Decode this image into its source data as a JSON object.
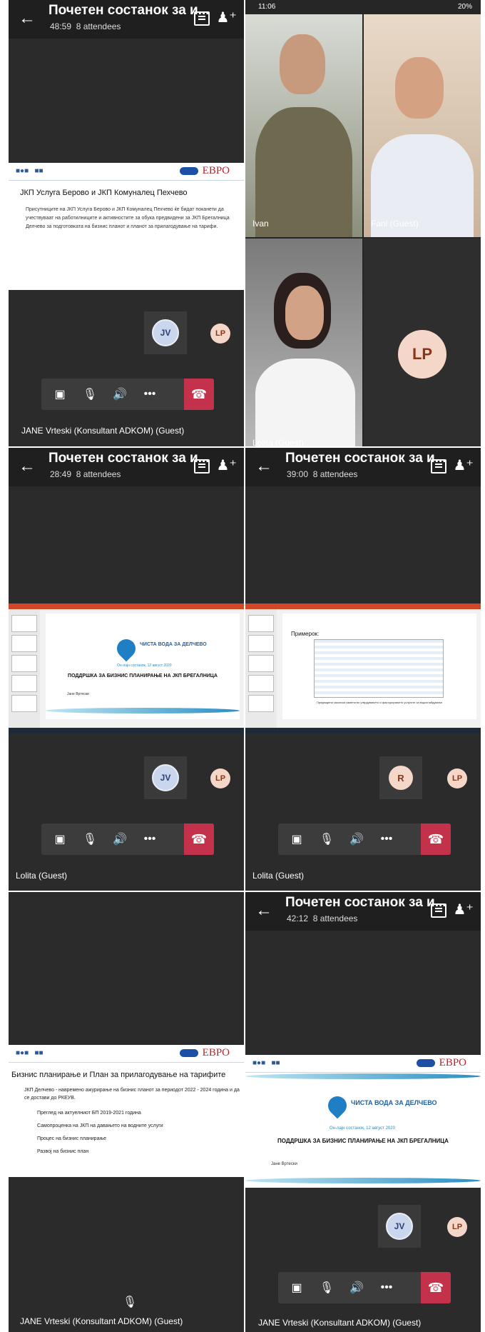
{
  "panels": {
    "p1": {
      "meeting_title": "Почетен состанок за и...",
      "timer": "48:59",
      "attendees": "8 attendees",
      "slide": {
        "title": "ЈКП Услуга Берово и ЈКП Комуналец Пехчево",
        "body": "Присутниците на ЈКП Услуга Берово и ЈКП Комуналец Пехчево ќе бидат поканети да учествуваат на работилниците и активностите за обука предвидени за ЈКП Брегалница Делчево за подготовката на бизнис планот и планот за прилагодување на тарифи.",
        "evro": "EBPO"
      },
      "avatar_tile": "JV",
      "avatar_small": "LP",
      "participant_name": "JANE  Vrteski (Konsultant ADKOM) (Guest)"
    },
    "p2": {
      "status_time": "11:06",
      "status_right": "20%",
      "tiles": [
        {
          "name": "Ivan"
        },
        {
          "name": "Fani (Guest)"
        },
        {
          "name": "Lolita (Guest)"
        }
      ],
      "avatar_big": "LP"
    },
    "p3": {
      "meeting_title": "Почетен состанок за и...",
      "timer": "28:49",
      "attendees": "8 attendees",
      "slide": {
        "brand": "ЧИСТА ВОДА ЗА ДЕЛЧЕВО",
        "date": "Он-лајн состанок, 12 август 2020",
        "title": "ПОДДРШКА ЗА БИЗНИС ПЛАНИРАЊЕ НА ЈКП БРЕГАЛНИЦА",
        "author": "Јане Вртески"
      },
      "avatar_tile": "JV",
      "avatar_small": "LP",
      "participant_name": "Lolita (Guest)"
    },
    "p4": {
      "meeting_title": "Почетен состанок за и...",
      "timer": "39:00",
      "attendees": "8 attendees",
      "slide": {
        "title": "Примерок:",
        "caption": "Предвидени законски измени во утврдувањето и фактурирањето услугите за водоснабдување"
      },
      "avatar_tile": "R",
      "avatar_small": "LP",
      "participant_name": "Lolita (Guest)"
    },
    "p5": {
      "slide": {
        "title": "Бизнис планирање и План за прилагодување на тарифите",
        "bullets": [
          "ЈКП Делчево - навремено ажурирање на бизнис планот за периодот 2022 - 2024 година и да се достави до РКЕУВ.",
          "Преглед на актуелниот БП 2019-2021 година",
          "Самопроценка на ЈКП на давањето на водните услуги",
          "Процес на бизнис планирање",
          "Развој на бизнис план"
        ]
      },
      "participant_name": "JANE  Vrteski (Konsultant ADKOM) (Guest)"
    },
    "p6": {
      "meeting_title": "Почетен состанок за и...",
      "timer": "42:12",
      "attendees": "8 attendees",
      "slide": {
        "brand": "ЧИСТА ВОДА ЗА ДЕЛЧЕВО",
        "date": "Он-лајн состанок, 12 август 2020",
        "title": "ПОДДРШКА ЗА БИЗНИС ПЛАНИРАЊЕ НА ЈКП БРЕГАЛНИЦА",
        "author": "Јане Вртески"
      },
      "avatar_tile": "JV",
      "avatar_small": "LP",
      "participant_name": "JANE  Vrteski (Konsultant ADKOM) (Guest)"
    }
  },
  "colors": {
    "hangup": "#c4314b",
    "panel": "#2b2b2b",
    "header": "#1f1f1f"
  },
  "icons": [
    "back-arrow-icon",
    "chat-icon",
    "people-add-icon",
    "video-off-icon",
    "mic-off-icon",
    "speaker-icon",
    "more-icon",
    "hangup-icon"
  ]
}
